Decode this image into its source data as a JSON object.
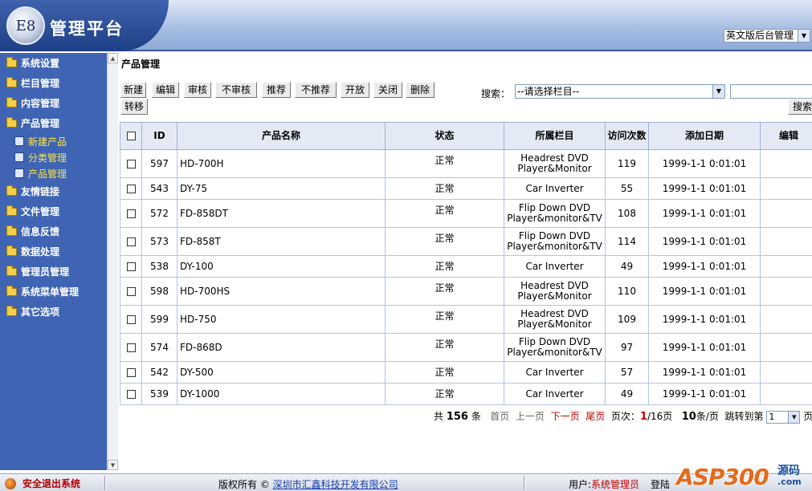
{
  "header": {
    "logo_text": "E8",
    "title": "管理平台",
    "lang_select_value": "英文版后台管理"
  },
  "sidebar": {
    "items": [
      {
        "label": "系统设置"
      },
      {
        "label": "栏目管理"
      },
      {
        "label": "内容管理"
      },
      {
        "label": "产品管理"
      }
    ],
    "sub_items": [
      {
        "label": "新建产品"
      },
      {
        "label": "分类管理"
      },
      {
        "label": "产品管理"
      }
    ],
    "items_after": [
      {
        "label": "友情链接"
      },
      {
        "label": "文件管理"
      },
      {
        "label": "信息反馈"
      },
      {
        "label": "数据处理"
      },
      {
        "label": "管理员管理"
      },
      {
        "label": "系统菜单管理"
      },
      {
        "label": "其它选项"
      }
    ]
  },
  "main": {
    "page_title": "产品管理",
    "toolbar": {
      "new": "新建",
      "edit": "编辑",
      "audit": "审核",
      "unaudit": "不审核",
      "recommend": "推荐",
      "unrecommend": "不推荐",
      "open": "开放",
      "close": "关闭",
      "delete": "删除",
      "move": "转移"
    },
    "search": {
      "label": "搜索：",
      "select_value": "--请选择栏目--",
      "button": "搜索"
    },
    "table": {
      "headers": [
        "ID",
        "产品名称",
        "状态",
        "所属栏目",
        "访问次数",
        "添加日期",
        "编辑"
      ],
      "rows": [
        {
          "id": "597",
          "name": "HD-700H",
          "status": "正常",
          "category": "Headrest DVD Player&Monitor",
          "visits": "119",
          "date": "1999-1-1 0:01:01"
        },
        {
          "id": "543",
          "name": "DY-75",
          "status": "正常",
          "category": "Car Inverter",
          "visits": "55",
          "date": "1999-1-1 0:01:01"
        },
        {
          "id": "572",
          "name": "FD-858DT",
          "status": "正常",
          "category": "Flip Down DVD Player&monitor&TV",
          "visits": "108",
          "date": "1999-1-1 0:01:01"
        },
        {
          "id": "573",
          "name": "FD-858T",
          "status": "正常",
          "category": "Flip Down DVD Player&monitor&TV",
          "visits": "114",
          "date": "1999-1-1 0:01:01"
        },
        {
          "id": "538",
          "name": "DY-100",
          "status": "正常",
          "category": "Car Inverter",
          "visits": "49",
          "date": "1999-1-1 0:01:01"
        },
        {
          "id": "598",
          "name": "HD-700HS",
          "status": "正常",
          "category": "Headrest DVD Player&Monitor",
          "visits": "110",
          "date": "1999-1-1 0:01:01"
        },
        {
          "id": "599",
          "name": "HD-750",
          "status": "正常",
          "category": "Headrest DVD Player&Monitor",
          "visits": "109",
          "date": "1999-1-1 0:01:01"
        },
        {
          "id": "574",
          "name": "FD-868D",
          "status": "正常",
          "category": "Flip Down DVD Player&monitor&TV",
          "visits": "97",
          "date": "1999-1-1 0:01:01"
        },
        {
          "id": "542",
          "name": "DY-500",
          "status": "正常",
          "category": "Car Inverter",
          "visits": "57",
          "date": "1999-1-1 0:01:01"
        },
        {
          "id": "539",
          "name": "DY-1000",
          "status": "正常",
          "category": "Car Inverter",
          "visits": "49",
          "date": "1999-1-1 0:01:01"
        }
      ]
    },
    "pager": {
      "total_prefix": "共",
      "total": "156",
      "total_suffix": "条",
      "first": "首页",
      "prev": "上一页",
      "next": "下一页",
      "last": "尾页",
      "page_label": "页次：",
      "current": "1",
      "pages": "/16页",
      "per_page": "10",
      "per_page_suffix": "条/页",
      "jump_label": "跳转到第",
      "jump_value": "1",
      "jump_suffix": "页"
    }
  },
  "footer": {
    "logout": "安全退出系统",
    "copyright_prefix": "版权所有 ©",
    "company": "深圳市汇鑫科技开发有限公司",
    "user_prefix": "用户:",
    "user_name": "系统管理员",
    "login_label": "登陆"
  },
  "watermark": {
    "text": "ASP300",
    "cn": "源码",
    "com": ".com"
  }
}
